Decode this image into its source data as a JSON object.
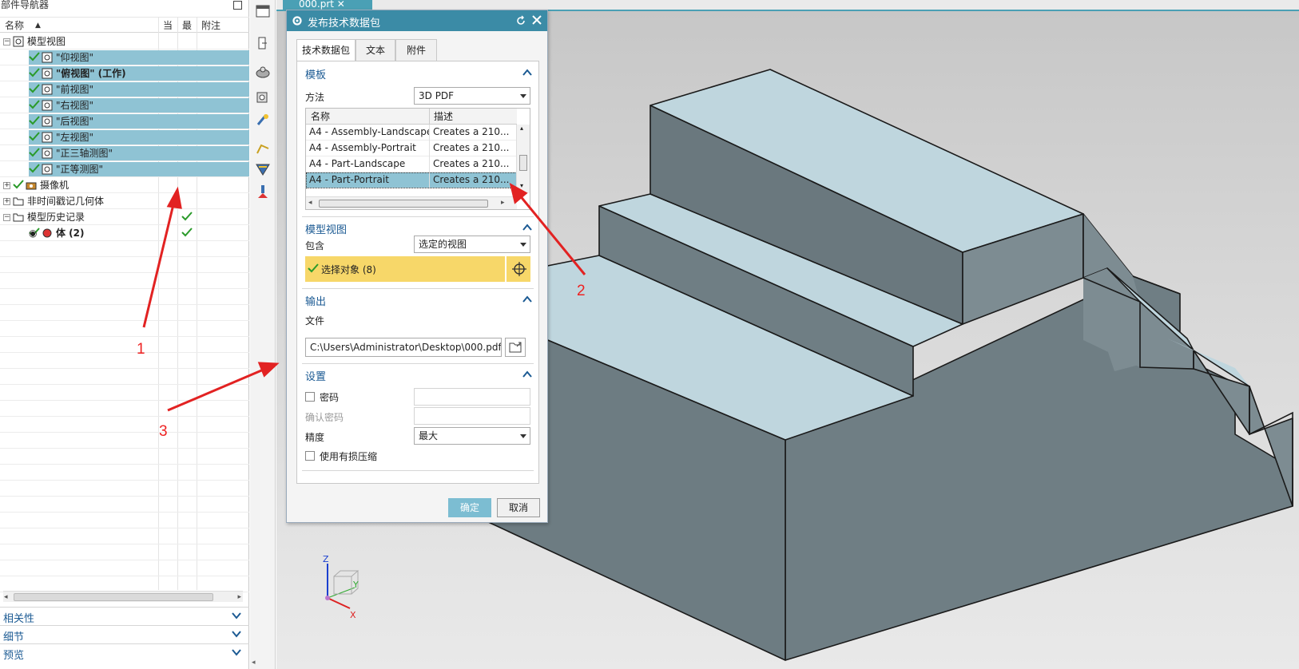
{
  "navigator": {
    "title": "部件导航器",
    "columns": {
      "name": "名称",
      "current": "当",
      "latest": "最",
      "attached": "附注"
    },
    "tree": [
      {
        "label": "模型视图",
        "indent": 0,
        "expander": "−"
      },
      {
        "label": "\"仰视图\"",
        "indent": 1,
        "selected": true
      },
      {
        "label": "\"俯视图\" (工作)",
        "indent": 1,
        "selected": true,
        "bold": true
      },
      {
        "label": "\"前视图\"",
        "indent": 1,
        "selected": true
      },
      {
        "label": "\"右视图\"",
        "indent": 1,
        "selected": true
      },
      {
        "label": "\"后视图\"",
        "indent": 1,
        "selected": true
      },
      {
        "label": "\"左视图\"",
        "indent": 1,
        "selected": true
      },
      {
        "label": "\"正三轴测图\"",
        "indent": 1,
        "selected": true
      },
      {
        "label": "\"正等测图\"",
        "indent": 1,
        "selected": true
      },
      {
        "label": "摄像机",
        "indent": 0,
        "expander": "+"
      },
      {
        "label": "非时间戳记几何体",
        "indent": 0,
        "expander": "+"
      },
      {
        "label": "模型历史记录",
        "indent": 0,
        "expander": "−"
      },
      {
        "label": "体 (2)",
        "indent": 1,
        "bold": true
      }
    ],
    "panels": [
      "相关性",
      "细节",
      "预览"
    ]
  },
  "tab": {
    "label": "000.prt"
  },
  "dialog": {
    "title": "发布技术数据包",
    "tabs": [
      "技术数据包",
      "文本",
      "附件"
    ],
    "template": {
      "title": "模板",
      "method_label": "方法",
      "method_value": "3D PDF",
      "table_headers": [
        "名称",
        "描述"
      ],
      "rows": [
        {
          "name": "A4 - Assembly-Landscape",
          "desc": "Creates a 210..."
        },
        {
          "name": "A4 - Assembly-Portrait",
          "desc": "Creates a 210..."
        },
        {
          "name": "A4 - Part-Landscape",
          "desc": "Creates a 210..."
        },
        {
          "name": "A4 - Part-Portrait",
          "desc": "Creates a 210...",
          "selected": true
        }
      ]
    },
    "model_views": {
      "title": "模型视图",
      "include_label": "包含",
      "include_value": "选定的视图",
      "select_text": "选择对象 (8)"
    },
    "output": {
      "title": "输出",
      "file_label": "文件",
      "file_value": "C:\\Users\\Administrator\\Desktop\\000.pdf"
    },
    "settings": {
      "title": "设置",
      "password_label": "密码",
      "confirm_password_label": "确认密码",
      "precision_label": "精度",
      "precision_value": "最大",
      "lossy_label": "使用有损压缩"
    },
    "ok_label": "确定",
    "cancel_label": "取消"
  },
  "annotations": {
    "a1": "1",
    "a2": "2",
    "a3": "3"
  },
  "triad": {
    "z": "Z",
    "y": "Y",
    "x": "X"
  },
  "colors": {
    "accent": "#3b8ba6",
    "selection": "#8fc3d4",
    "select_bar": "#f7d769",
    "annotation": "#e22222"
  }
}
